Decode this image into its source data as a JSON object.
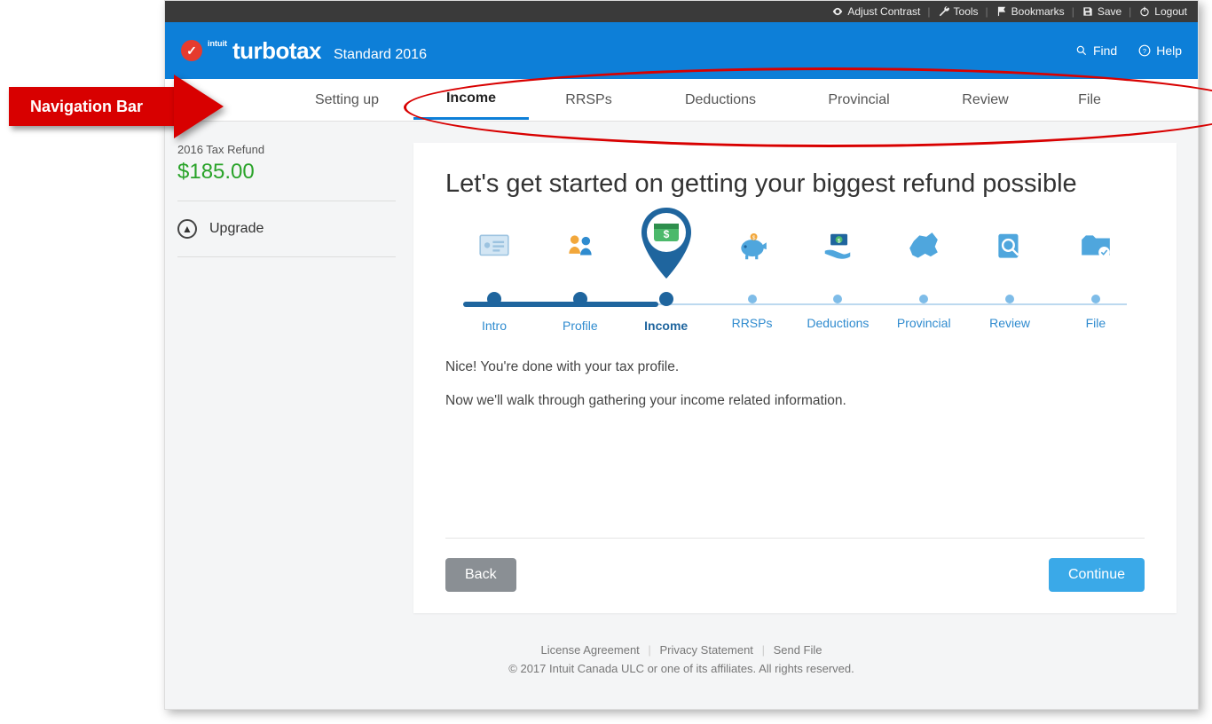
{
  "annotation": {
    "label": "Navigation Bar"
  },
  "topbar": {
    "contrast": "Adjust Contrast",
    "tools": "Tools",
    "bookmarks": "Bookmarks",
    "save": "Save",
    "logout": "Logout"
  },
  "brand": {
    "intuit": "intuit",
    "name": "turbotax",
    "suffix": "Standard 2016",
    "find": "Find",
    "help": "Help"
  },
  "nav": {
    "tabs": [
      "Setting up",
      "Income",
      "RRSPs",
      "Deductions",
      "Provincial",
      "Review",
      "File"
    ],
    "active_index": 1
  },
  "sidebar": {
    "refund_label": "2016 Tax Refund",
    "refund_amount": "$185.00",
    "upgrade": "Upgrade"
  },
  "main": {
    "heading": "Let's get started on getting your biggest refund possible",
    "steps": [
      "Intro",
      "Profile",
      "Income",
      "RRSPs",
      "Deductions",
      "Provincial",
      "Review",
      "File"
    ],
    "current_step_index": 2,
    "body1": "Nice! You're done with your tax profile.",
    "body2": "Now we'll walk through gathering your income related information.",
    "back": "Back",
    "continue": "Continue"
  },
  "footer": {
    "links": [
      "License Agreement",
      "Privacy Statement",
      "Send File"
    ],
    "copyright": "© 2017 Intuit Canada ULC or one of its affiliates. All rights reserved."
  }
}
